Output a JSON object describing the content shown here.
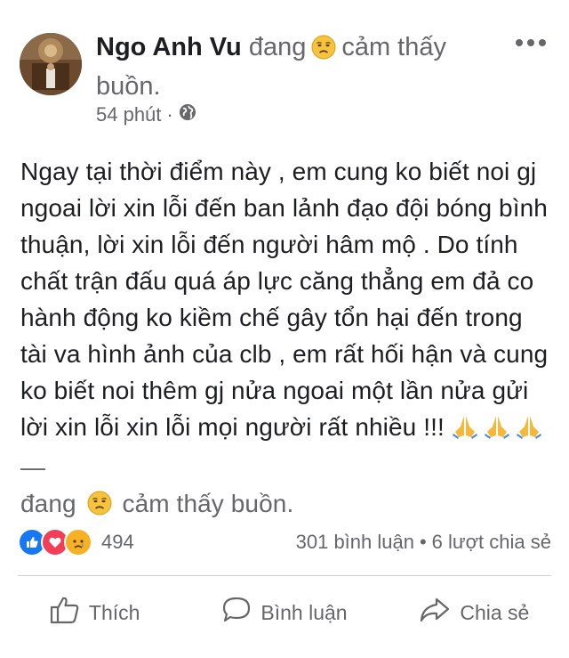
{
  "post": {
    "author": "Ngo Anh Vu",
    "feeling_prefix": "đang",
    "feeling_text": "cảm thấy buồn.",
    "feeling_icon": "sad-face-icon",
    "time": "54 phút",
    "time_separator": "·",
    "privacy_icon": "globe-icon",
    "body": "Ngay tại thời điểm này , em cung ko biết noi gj ngoai lời xin lỗi đến ban lảnh đạo đội bóng bình thuận, lời xin lỗi đến người hâm mộ . Do tính chất trận đấu quá áp lực căng thẳng em đả co hành động ko kiềm chế gây tổn hại đến trong tài va hình ảnh của clb , em rất hối hận và cung ko biết noi thêm gj nửa ngoai một lần nửa gửi lời xin lỗi xin lỗi mọi người rất nhiều !!!",
    "body_emoji_icons": [
      "folded-hands-icon",
      "folded-hands-icon",
      "folded-hands-icon"
    ],
    "body_dash": "—",
    "body_feeling_prefix": "đang",
    "body_feeling_text": "cảm thấy buồn."
  },
  "stats": {
    "reaction_icons": [
      "like-icon",
      "love-icon",
      "sad-icon"
    ],
    "reactions_count": "494",
    "comments": "301 bình luận",
    "separator": "•",
    "shares": "6 lượt chia sẻ"
  },
  "actions": {
    "like_label": "Thích",
    "comment_label": "Bình luận",
    "share_label": "Chia sẻ"
  },
  "colors": {
    "like_blue": "#1877f2",
    "love_red": "#f33e58",
    "sad_yellow": "#f7b125",
    "secondary_text": "#65676b",
    "primary_text": "#1c1e21"
  }
}
